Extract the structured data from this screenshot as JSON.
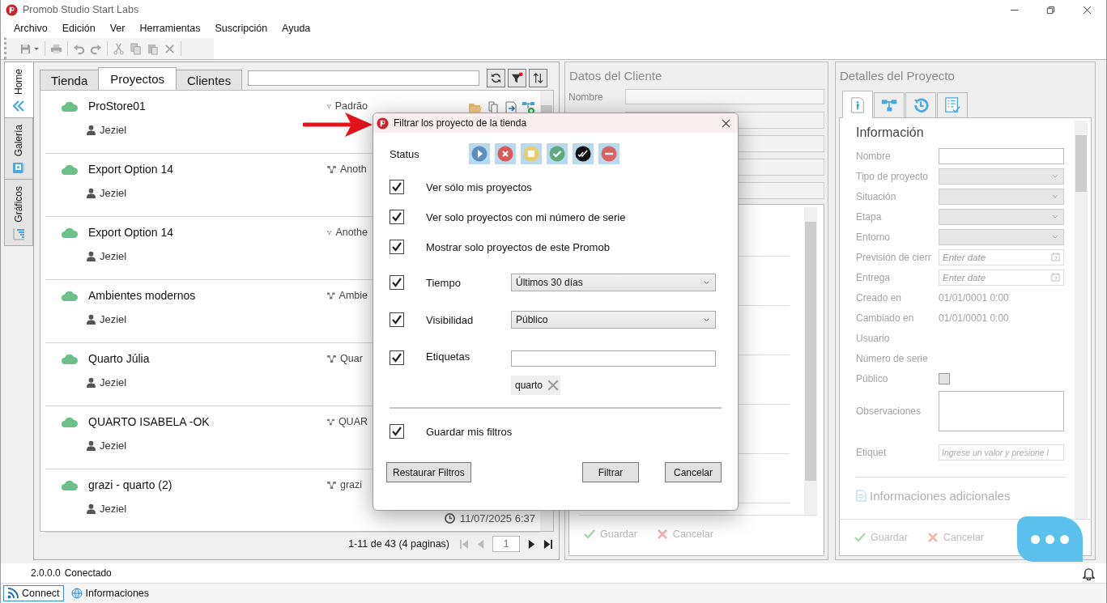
{
  "window": {
    "title": "Promob Studio Start Labs"
  },
  "menu": [
    "Archivo",
    "Edición",
    "Ver",
    "Herramientas",
    "Suscripción",
    "Ayuda"
  ],
  "side_tabs": [
    {
      "label": "Home",
      "kind": "home",
      "selected": true
    },
    {
      "label": "Galería",
      "kind": "gallery",
      "selected": false
    },
    {
      "label": "Gráficos",
      "kind": "charts",
      "selected": false
    }
  ],
  "projects": {
    "tabs": [
      {
        "label": "Tienda",
        "selected": false
      },
      {
        "label": "Proyectos",
        "selected": true
      },
      {
        "label": "Clientes",
        "selected": false
      }
    ],
    "rows": [
      {
        "name": "ProStore01",
        "user": "Jeziel",
        "branch": "Padrão",
        "actions": [
          {
            "kind": "open"
          },
          {
            "kind": "copy"
          },
          {
            "kind": "export"
          },
          {
            "kind": "share"
          }
        ]
      },
      {
        "name": "Export Option 14",
        "user": "Jeziel",
        "branch": "Anoth"
      },
      {
        "name": "Export Option 14",
        "user": "Jeziel",
        "branch": "Anothe"
      },
      {
        "name": "Ambientes modernos",
        "user": "Jeziel",
        "branch": "Ambie"
      },
      {
        "name": "Quarto Júlia",
        "user": "Jeziel",
        "branch": "Quar"
      },
      {
        "name": "QUARTO ISABELA -OK",
        "user": "Jeziel",
        "branch": "QUAR"
      },
      {
        "name": "grazi - quarto (2)",
        "user": "Jeziel",
        "branch": "grazi",
        "date": "11/07/2025 6:37"
      }
    ],
    "pagination": {
      "summary": "1-11 de 43 (4 paginas)",
      "page": "1"
    }
  },
  "client": {
    "title": "Datos del Cliente",
    "name_label": "Nombre",
    "buttons": [
      "Guardar",
      "Cancelar"
    ]
  },
  "details": {
    "title": "Detalles del Proyecto",
    "tabs": [
      {
        "kind": "info",
        "selected": true
      },
      {
        "kind": "hierarchy",
        "selected": false
      },
      {
        "kind": "history",
        "selected": false
      },
      {
        "kind": "checklist",
        "selected": false
      }
    ],
    "section": "Información",
    "fields": [
      {
        "label": "Nombre",
        "kind": "text"
      },
      {
        "label": "Tipo de proyecto",
        "kind": "select"
      },
      {
        "label": "Situación",
        "kind": "select"
      },
      {
        "label": "Etapa",
        "kind": "select"
      },
      {
        "label": "Entorno",
        "kind": "select"
      },
      {
        "label": "Previsión de cierr",
        "kind": "date",
        "placeholder": "Enter date"
      },
      {
        "label": "Entrega",
        "kind": "date",
        "placeholder": "Enter date"
      },
      {
        "label": "Creado en",
        "kind": "value",
        "value": "01/01/0001 0:00"
      },
      {
        "label": "Cambiado en",
        "kind": "value",
        "value": "01/01/0001 0:00"
      },
      {
        "label": "Usuario",
        "kind": "value"
      },
      {
        "label": "Número de serie",
        "kind": "value"
      },
      {
        "label": "Público",
        "kind": "checkbox",
        "checked": false
      },
      {
        "label": "Observaciones",
        "kind": "textarea"
      },
      {
        "label": "Etiquet",
        "kind": "tags",
        "placeholder": "Ingrese un valor y presione l"
      }
    ],
    "additional": "Informaciones adicionales",
    "buttons": [
      "Guardar",
      "Cancelar"
    ]
  },
  "status": {
    "version": "2.0.0.0",
    "connection": "Conectado"
  },
  "taskbar": [
    {
      "label": "Connect",
      "kind": "feed",
      "selected": true
    },
    {
      "label": "Informaciones",
      "kind": "globe",
      "selected": false
    }
  ],
  "dialog": {
    "title": "Filtrar los proyecto de la tienda",
    "status_label": "Status",
    "statuses": [
      {
        "kind": "play",
        "color": "#5b8fbf",
        "selected": true
      },
      {
        "kind": "cancel",
        "color": "#d9595b",
        "selected": true
      },
      {
        "kind": "stop",
        "color": "#e8cc6e",
        "selected": true
      },
      {
        "kind": "check",
        "color": "#5fa97e",
        "selected": true
      },
      {
        "kind": "done",
        "color": "#111111",
        "selected": true
      },
      {
        "kind": "minus",
        "color": "#d96263",
        "selected": true
      }
    ],
    "options": [
      {
        "kind": "check",
        "label": "Ver sólo mis proyectos",
        "checked": true
      },
      {
        "kind": "check",
        "label": "Ver solo proyectos con mi número de serie",
        "checked": true
      },
      {
        "kind": "check",
        "label": "Mostrar solo proyectos de este Promob",
        "checked": true
      },
      {
        "kind": "select",
        "label": "Tiempo",
        "value": "Últimos 30 días",
        "checked": true
      },
      {
        "kind": "select",
        "label": "Visibilidad",
        "value": "Público",
        "checked": true
      },
      {
        "kind": "tags",
        "label": "Etiquetas",
        "tags": [
          "quarto"
        ],
        "checked": true
      }
    ],
    "save": {
      "label": "Guardar mis filtros",
      "checked": true
    },
    "buttons": [
      "Restaurar Filtros",
      "Filtrar",
      "Cancelar"
    ]
  }
}
